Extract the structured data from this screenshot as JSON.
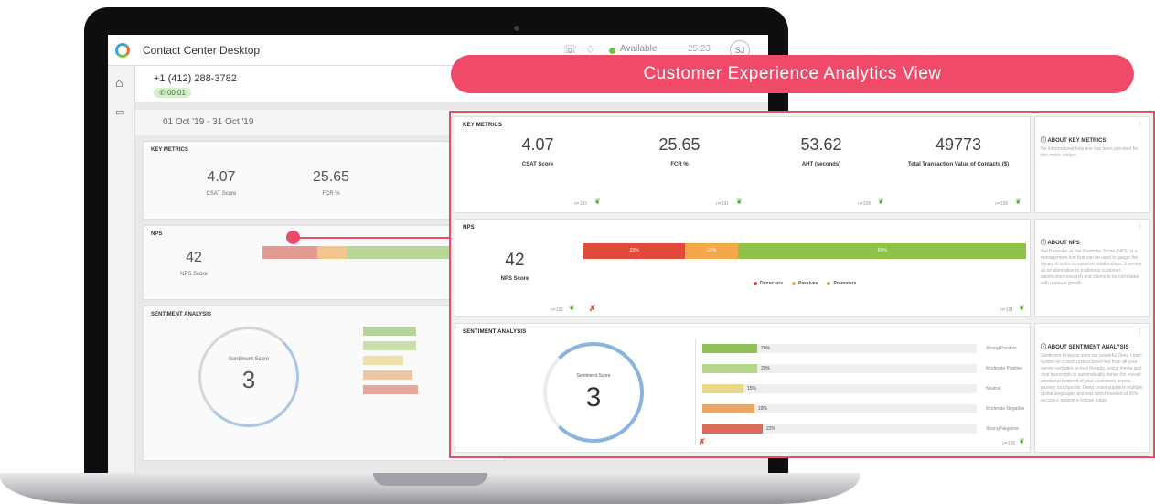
{
  "app": {
    "title": "Contact Center Desktop",
    "status": "Available",
    "clock": "25:23",
    "avatar": "SJ"
  },
  "call": {
    "phone": "+1 (412) 288-3782",
    "timer": "00:01"
  },
  "date_range": "01 Oct '19 - 31 Oct '19",
  "banner": "Customer  Experience  Analytics  View",
  "colors": {
    "accent": "#ef4a67",
    "detractors": "#e04a3b",
    "passives": "#f3a84a",
    "promoters": "#8fc24a",
    "ring": "#8ab4e0"
  },
  "key_metrics": {
    "title": "KEY METRICS",
    "items": [
      {
        "value": "4.07",
        "label": "CSAT Score",
        "n": "n=182"
      },
      {
        "value": "25.65",
        "label": "FCR %",
        "n": "n=191"
      },
      {
        "value": "53.62",
        "label": "AHT (seconds)",
        "n": "n=158"
      },
      {
        "value": "49773",
        "label": "Total Transaction Value of Contacts ($)",
        "n": "n=158"
      }
    ],
    "about_title": "ABOUT KEY METRICS",
    "about_text": "No informational help text has been provided for this metric widget."
  },
  "nps": {
    "title": "NPS",
    "score": "42",
    "score_label": "NPS Score",
    "n": "n=191",
    "segments": [
      {
        "name": "Detractors",
        "pct": 23,
        "label": "23%"
      },
      {
        "name": "Passives",
        "pct": 12,
        "label": "12%"
      },
      {
        "name": "Promoters",
        "pct": 65,
        "label": "65%"
      }
    ],
    "about_title": "ABOUT NPS",
    "about_text": "Net Promoter or Net Promoter Score (NPS) is a management tool that can be used to gauge the loyalty of a firm's customer relationships. It serves as an alternative to traditional customer satisfaction research and claims to be correlated with revenue growth."
  },
  "sentiment": {
    "title": "SENTIMENT ANALYSIS",
    "score_label": "Sentiment Score",
    "score": "3",
    "n": "n=158",
    "rows": [
      {
        "label": "Strong Positive",
        "pct": 20,
        "text": "20%",
        "color": "#8fc05a"
      },
      {
        "label": "Moderate Positive",
        "pct": 20,
        "text": "20%",
        "color": "#b5d78a"
      },
      {
        "label": "Neutral",
        "pct": 15,
        "text": "15%",
        "color": "#e8d98a"
      },
      {
        "label": "Moderate Negative",
        "pct": 19,
        "text": "19%",
        "color": "#e8a86a"
      },
      {
        "label": "Strong Negative",
        "pct": 22,
        "text": "22%",
        "color": "#dd6a5a"
      }
    ],
    "about_title": "ABOUT SENTIMENT ANALYSIS",
    "about_text": "Sentiment Analysis uses our powerful Deep Learn system to crunch unstructured text from all your survey verbatim, e-mail threads, social media and chat transcripts to automatically derive the overall emotional footprint of your customers across journey touchpoints. Deep Learn supports multiple global languages and was benchmarked at 96% accuracy against a human judge."
  }
}
